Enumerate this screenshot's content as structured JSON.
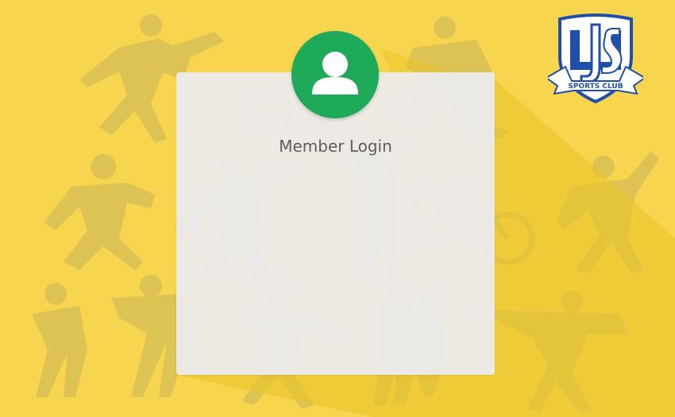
{
  "login": {
    "title": "Member Login",
    "avatar_icon": "user-icon"
  },
  "logo": {
    "icon": "sports-club-shield-logo",
    "text": "SPORTS CLUB"
  },
  "colors": {
    "background": "#f7d54e",
    "avatar": "#1faa59",
    "card": "#ececf0",
    "shield_blue": "#1f4fa8"
  }
}
